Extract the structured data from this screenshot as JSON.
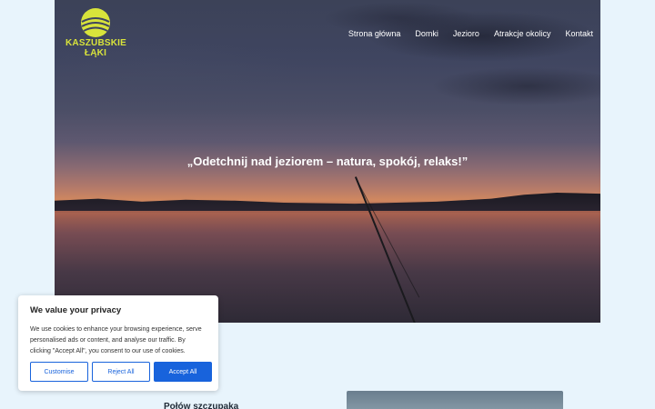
{
  "brand": {
    "line1": "KASZUBSKIE",
    "line2": "ŁĄKI",
    "color": "#d8e33b"
  },
  "nav": {
    "items": [
      "Strona główna",
      "Domki",
      "Jezioro",
      "Atrakcje okolicy",
      "Kontakt"
    ]
  },
  "hero": {
    "quote": "„Odetchnij nad jeziorem – natura, spokój, relaks!”"
  },
  "section": {
    "heading": "Połów szczupaka"
  },
  "cookie": {
    "title": "We value your privacy",
    "text": "We use cookies to enhance your browsing experience, serve personalised ads or content, and analyse our traffic. By clicking \"Accept All\", you consent to our use of cookies.",
    "customise": "Customise",
    "reject": "Reject All",
    "accept": "Accept All",
    "accent": "#1863dc"
  },
  "icons": {
    "logo": "sun-over-hills-logo-icon"
  }
}
